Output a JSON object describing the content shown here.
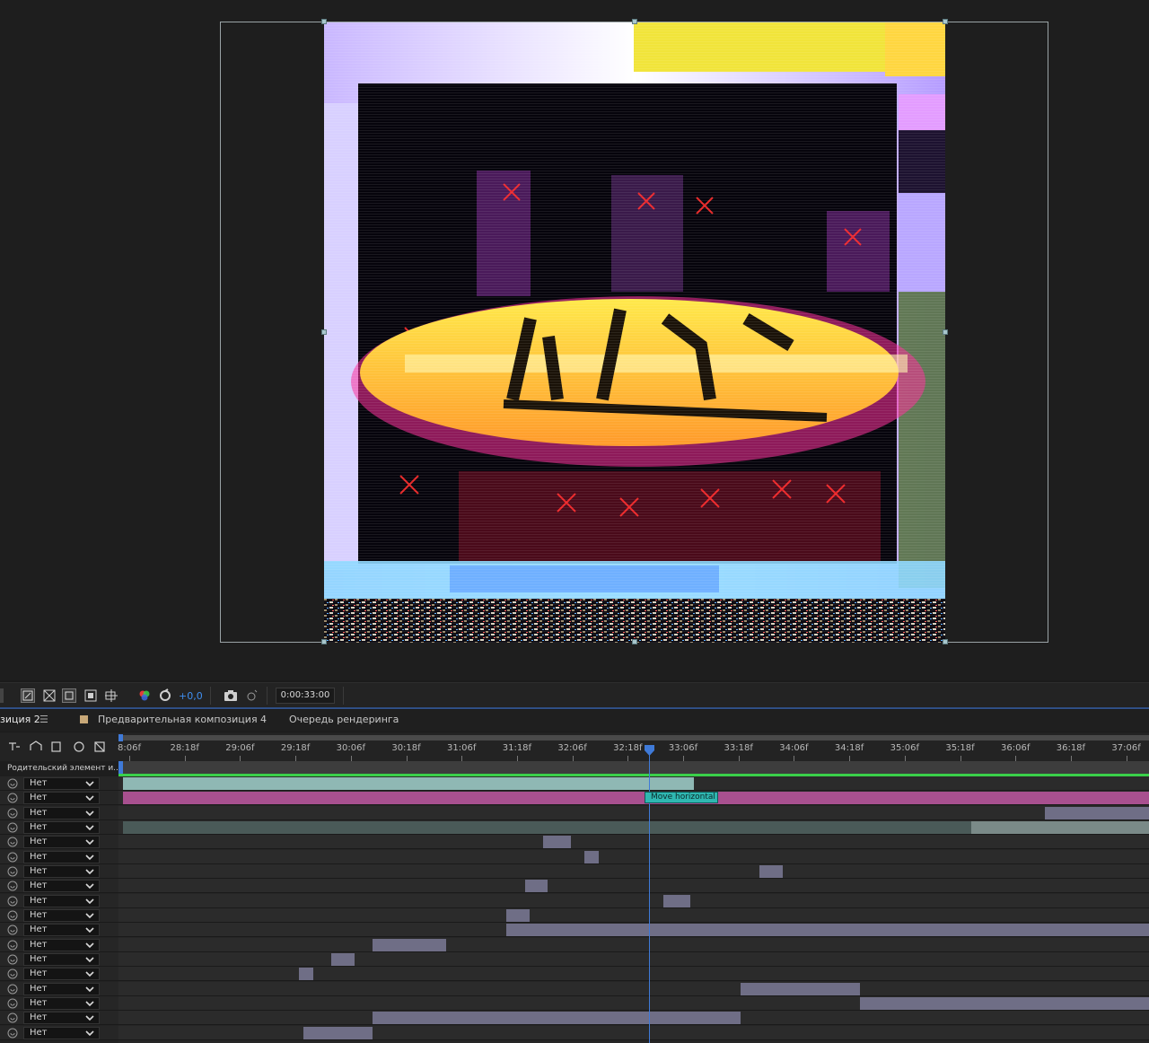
{
  "toolbar": {
    "exposure_value": "+0,0",
    "timecode": "0:00:33:00"
  },
  "tabs": {
    "comp_tab": "зиция 2",
    "precomp_tab": "Предварительная композиция 4",
    "render_queue_tab": "Очередь рендеринга"
  },
  "timeline": {
    "parent_column_header": "Родительский элемент и...",
    "ticks": [
      "8:06f",
      "28:18f",
      "29:06f",
      "29:18f",
      "30:06f",
      "30:18f",
      "31:06f",
      "31:18f",
      "32:06f",
      "32:18f",
      "33:06f",
      "33:18f",
      "34:06f",
      "34:18f",
      "35:06f",
      "35:18f",
      "36:06f",
      "36:18f",
      "37:06f"
    ],
    "marker_label": "Move horizontal",
    "layers": [
      {
        "parent": "Нет"
      },
      {
        "parent": "Нет"
      },
      {
        "parent": "Нет"
      },
      {
        "parent": "Нет"
      },
      {
        "parent": "Нет"
      },
      {
        "parent": "Нет"
      },
      {
        "parent": "Нет"
      },
      {
        "parent": "Нет"
      },
      {
        "parent": "Нет"
      },
      {
        "parent": "Нет"
      },
      {
        "parent": "Нет"
      },
      {
        "parent": "Нет"
      },
      {
        "parent": "Нет"
      },
      {
        "parent": "Нет"
      },
      {
        "parent": "Нет"
      },
      {
        "parent": "Нет"
      },
      {
        "parent": "Нет"
      },
      {
        "parent": "Нет"
      }
    ]
  },
  "colors": {
    "cti": "#3f7ad8",
    "marker": "#2fb7b1",
    "bar_teal": "#8fb8b4",
    "bar_magenta": "#a8508f",
    "bar_grey": "#6f6e86",
    "bar_darkteal": "#4a5a58"
  }
}
